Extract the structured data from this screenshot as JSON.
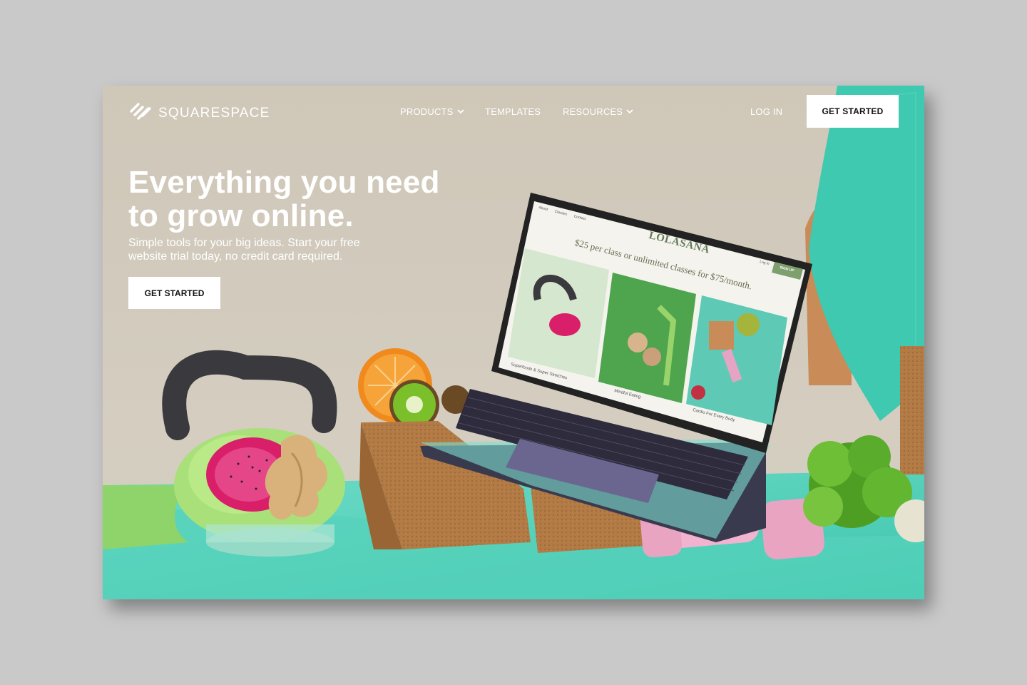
{
  "brand": {
    "name": "SQUARESPACE",
    "logo_icon": "squarespace-logo-icon"
  },
  "nav": {
    "items": [
      {
        "label": "PRODUCTS",
        "has_dropdown": true
      },
      {
        "label": "TEMPLATES",
        "has_dropdown": false
      },
      {
        "label": "RESOURCES",
        "has_dropdown": true
      }
    ],
    "login_label": "LOG IN",
    "cta_label": "GET STARTED"
  },
  "hero": {
    "title_line1": "Everything you need",
    "title_line2": "to grow online.",
    "subtitle_line1": "Simple tools for your big ideas. Start your free",
    "subtitle_line2": "website trial today, no credit card required.",
    "cta_label": "GET STARTED"
  },
  "laptop_screen": {
    "nav_links": [
      "About",
      "Classes",
      "Contact"
    ],
    "site_title": "LOLASANA",
    "tagline": "$25 per class or unlimited classes for $75/month.",
    "login_label": "Log in",
    "signup_label": "SIGN UP",
    "captions": [
      "Superfoods & Super Stretches",
      "Mindful Eating",
      "Cardio For Every Body"
    ]
  },
  "colors": {
    "background": "#c9c9c9",
    "wall": "#cdc6b8",
    "mat": "#5fd6c0",
    "cta_bg": "#ffffff",
    "cta_text": "#111111"
  }
}
